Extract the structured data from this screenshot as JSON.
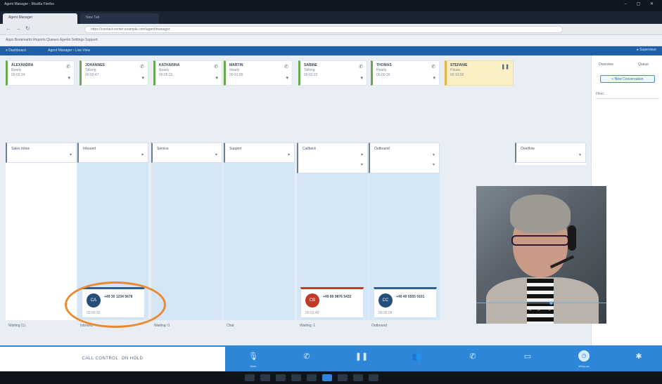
{
  "browser": {
    "title": "Agent Manager - Mozilla Firefox",
    "window_controls": "– ▢ ✕",
    "tabs": [
      "Agent Manager",
      "New Tab"
    ],
    "url": "https://contact-center.example.com/agent/manager",
    "nav_back": "←",
    "nav_forward": "→",
    "nav_reload": "↻",
    "bookmarks": "Apps   Bookmarks   Reports   Queues   Agents   Settings   Support"
  },
  "app": {
    "menu_label": "≡  Dashboard",
    "breadcrumb": "Agent Manager  ›  Live View",
    "user_label": "●  Supervisor"
  },
  "agents": [
    {
      "name": "ALEXANDRA",
      "status": "Ready",
      "time": "00:02:14",
      "icon": "phone-icon"
    },
    {
      "name": "JOHANNES",
      "status": "Talking",
      "time": "00:00:47",
      "icon": "phone-icon"
    },
    {
      "name": "KATHARINA",
      "status": "Ready",
      "time": "00:05:31",
      "icon": "phone-icon"
    },
    {
      "name": "MARTIN",
      "status": "Ready",
      "time": "00:01:09",
      "icon": "phone-icon"
    },
    {
      "name": "SABINE",
      "status": "Talking",
      "time": "00:03:22",
      "icon": "phone-icon"
    },
    {
      "name": "THOMAS",
      "status": "Ready",
      "time": "00:00:15",
      "icon": "phone-icon"
    },
    {
      "name": "STEFANIE",
      "status": "Pause",
      "time": "00:10:02",
      "icon": "pause-icon"
    }
  ],
  "right_panel": {
    "tab_overview": "Overview",
    "tab_queue": "Queue",
    "button": "+ New Conversation",
    "filter": "Filter..."
  },
  "queues": [
    {
      "title": "Sales Inbox",
      "footer": "Waiting (1)"
    },
    {
      "title": "Inbound",
      "footer": "Inbound"
    },
    {
      "title": "Service",
      "footer": "Waiting: 0"
    },
    {
      "title": "Support",
      "footer": "Chat"
    },
    {
      "title": "Callback",
      "footer": "Waiting: 1"
    },
    {
      "title": "Outbound",
      "footer": "Outbound"
    },
    {
      "title": "Overflow",
      "footer": ""
    }
  ],
  "calls": [
    {
      "avatar": "CA",
      "number": "+49 30 1234 5678",
      "meta": "00:00:32"
    },
    {
      "avatar": "CB",
      "number": "+49 89 9876 5432",
      "meta": "00:01:48"
    },
    {
      "avatar": "CC",
      "number": "+49 40 5555 0101",
      "meta": "00:00:09"
    }
  ],
  "status_bar": {
    "text": "CALL CONTROL: ON HOLD"
  },
  "actions": [
    {
      "icon": "microphone-icon",
      "glyph": "🎙",
      "label": "Mute"
    },
    {
      "icon": "phone-icon",
      "glyph": "✆",
      "label": ""
    },
    {
      "icon": "pause-icon",
      "glyph": "❚❚",
      "label": ""
    },
    {
      "icon": "conference-icon",
      "glyph": "👥",
      "label": ""
    },
    {
      "icon": "transfer-icon",
      "glyph": "✆",
      "label": ""
    },
    {
      "icon": "folder-icon",
      "glyph": "▭",
      "label": ""
    },
    {
      "icon": "clock-icon",
      "glyph": "◷",
      "label": "Wrap-up"
    },
    {
      "icon": "settings-icon",
      "glyph": "✱",
      "label": ""
    }
  ],
  "webcam": {
    "controls": "◁ ▷ ◇"
  },
  "colors": {
    "accent": "#2e86d8",
    "header_blue": "#1e5fa7",
    "highlight_ring": "#e98a2f",
    "queue_column": "#d5e6f7",
    "call_red": "#c0392b",
    "call_blue": "#2b5f95"
  }
}
